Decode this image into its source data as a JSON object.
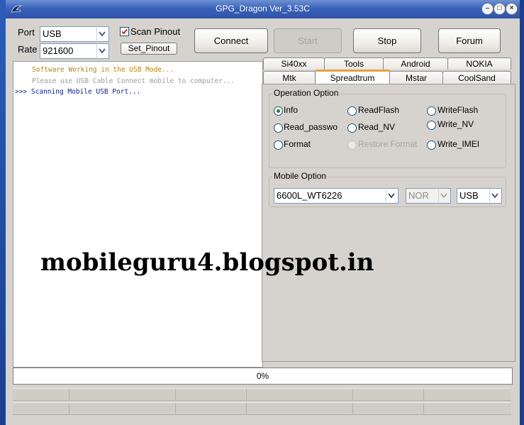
{
  "window": {
    "title": "GPG_Dragon  Ver_3.53C"
  },
  "connection": {
    "port_label": "Port",
    "port_value": "USB",
    "rate_label": "Rate",
    "rate_value": "921600",
    "scan_pinout_label": "Scan Pinout",
    "scan_pinout_checked": true,
    "set_pinout_label": "Set_Pinout"
  },
  "toolbar": {
    "connect_label": "Connect",
    "start_label": "Start",
    "stop_label": "Stop",
    "forum_label": "Forum"
  },
  "log": {
    "lines": [
      {
        "prefix": "",
        "text": "Software Working in the USB Mode...",
        "color": "#b8860b"
      },
      {
        "prefix": "",
        "text": "Please use USB Cable Connect mobile to computer...",
        "color": "#9a9a9a"
      },
      {
        "prefix": ">>>",
        "text": "Scanning Mobile USB Port...",
        "color": "#0a1f8f"
      }
    ]
  },
  "tabs": {
    "row_top": [
      "Si40xx",
      "Tools",
      "Android",
      "NOKIA"
    ],
    "row_bottom": [
      "Mtk",
      "Spreadtrum",
      "Mstar",
      "CoolSand"
    ],
    "active": "Spreadtrum"
  },
  "operation_option": {
    "title": "Operation Option",
    "options": [
      {
        "label": "Info",
        "checked": true,
        "enabled": true
      },
      {
        "label": "ReadFlash",
        "checked": false,
        "enabled": true
      },
      {
        "label": "WriteFlash",
        "checked": false,
        "enabled": true
      },
      {
        "label": "Read_passwo",
        "checked": false,
        "enabled": true
      },
      {
        "label": "Read_NV",
        "checked": false,
        "enabled": true
      },
      {
        "label": "Write_NV",
        "checked": false,
        "enabled": true
      },
      {
        "label": "Format",
        "checked": false,
        "enabled": true
      },
      {
        "label": "Restore Format",
        "checked": false,
        "enabled": false
      },
      {
        "label": "Write_IMEI",
        "checked": false,
        "enabled": true
      }
    ]
  },
  "mobile_option": {
    "title": "Mobile Option",
    "model_value": "6600L_WT6226",
    "flash_value": "NOR",
    "interface_value": "USB"
  },
  "progress": {
    "percent_label": "0%",
    "value": 0
  },
  "watermark": {
    "text": "mobileguru4.blogspot.in"
  },
  "colors": {
    "title_bar": "#3a62b8",
    "active_tab_accent": "#e6a23a",
    "checked_radio": "#1a8c22"
  }
}
